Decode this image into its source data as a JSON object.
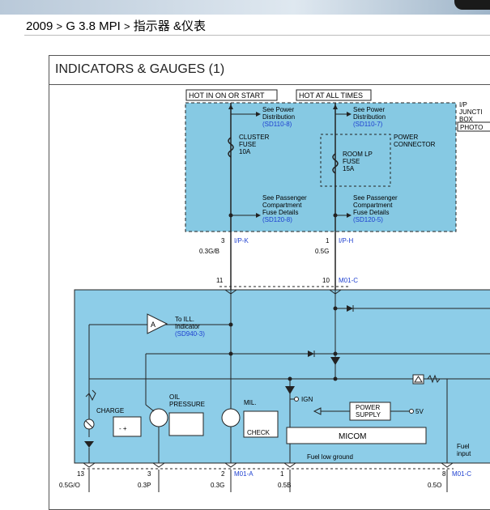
{
  "breadcrumb": {
    "year": "2009",
    "sep1": ">",
    "model": "G 3.8 MPI",
    "sep2": ">",
    "section": "指示器 &仪表"
  },
  "diagram": {
    "title": "INDICATORS & GAUGES (1)",
    "hot_start": "HOT IN ON OR START",
    "hot_always": "HOT AT ALL TIMES",
    "jb": [
      "I/P",
      "JUNCTI",
      "BOX"
    ],
    "photo": "PHOTO",
    "see_power": [
      "See Power",
      "Distribution"
    ],
    "sd110_8": "(SD110-8)",
    "sd110_7": "(SD110-7)",
    "cluster_fuse": [
      "CLUSTER",
      "FUSE",
      "10A"
    ],
    "power_connector": [
      "POWER",
      "CONNECTOR"
    ],
    "room_fuse": [
      "ROOM LP",
      "FUSE",
      "15A"
    ],
    "see_passenger": [
      "See Passenger",
      "Compartment",
      "Fuse Details"
    ],
    "sd120_8": "(SD120-8)",
    "sd120_5": "(SD120-5)",
    "pin3": "3",
    "ipk": "I/P-K",
    "wire_03gb": "0.3G/B",
    "pin1": "1",
    "iph": "I/P-H",
    "wire_05g": "0.5G",
    "pin11": "11",
    "pin10": "10",
    "m01c": "M01-C",
    "to_ill": [
      "To ILL.",
      "Indicator"
    ],
    "sd940_3": "(SD940-3)",
    "a_label": "A",
    "charge": "CHARGE",
    "oil_pressure": [
      "OIL",
      "PRESSURE"
    ],
    "mil": "MIL.",
    "check": "CHECK",
    "ign": "IGN",
    "power_supply": [
      "POWER",
      "SUPPLY"
    ],
    "five_v": "5V",
    "micom": "MICOM",
    "fuel_low_ground": "Fuel low ground",
    "fuel_input": [
      "Fuel",
      "input"
    ],
    "bottom_pins": [
      "13",
      "3",
      "2",
      "1",
      "8"
    ],
    "m01a": "M01-A",
    "bottom_wires": [
      "0.5G/O",
      "0.3P",
      "0.3G",
      "0.5B",
      "0.5O"
    ]
  },
  "colors": {
    "junction_fill": "#86c9e3",
    "cluster_fill": "#8dcde8",
    "ref_blue": "#1d3fd0"
  }
}
